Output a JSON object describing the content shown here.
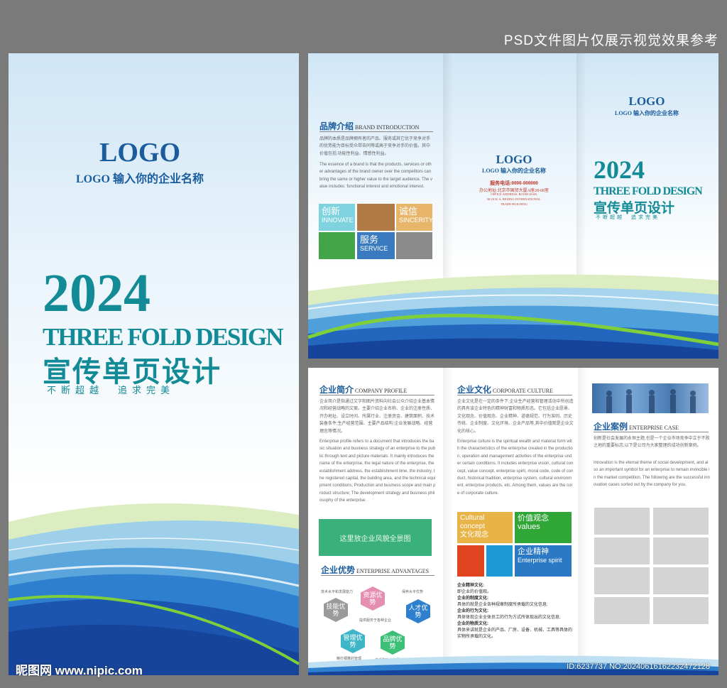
{
  "watermark_top": "PSD文件图片仅展示视觉效果参考",
  "watermark_site": "昵图网 www.nipic.com",
  "watermark_id": "ID:6237737 NO:20240616162232472128",
  "cover": {
    "logo": "LOGO",
    "company": "LOGO 输入你的企业名称",
    "year": "2024",
    "title_en": "THREE FOLD DESIGN",
    "title_cn": "宣传单页设计",
    "slogan": "不断超越　追求完美"
  },
  "outside": {
    "brand": {
      "heading": "品牌介绍",
      "heading_en": "BRAND INTRODUCTION",
      "text_cn": "品牌的本质是品牌拥有者的产品、服务或其它优于竞争对手的优势能为目标受众带去同等或高于竞争对手的价值。其中价值包括:功能性利益、情感性利益。",
      "text_en": "The essence of a brand is that the products, services or other advantages of the brand owner over the competitors can bring the same or higher value to the target audience. The value includes: functional interest and emotional interest."
    },
    "tiles": [
      {
        "cn": "创新",
        "en": "INNOVATE",
        "color": "#7fd3df"
      },
      {
        "cn": "",
        "en": "",
        "color": "#b07a45"
      },
      {
        "cn": "诚信",
        "en": "SINCERITY",
        "color": "#e7b66a"
      },
      {
        "cn": "",
        "en": "",
        "color": "#43a548"
      },
      {
        "cn": "服务",
        "en": "SERVICE",
        "color": "#3a7bbf"
      },
      {
        "cn": "",
        "en": "",
        "color": "#8a8a8a"
      }
    ],
    "back": {
      "logo": "LOGO",
      "company": "LOGO 输入你的企业名称",
      "phone": "服务电话:0000-000000",
      "address_cn": "办公地址:北京市国贸大厦A座28-08室",
      "address_en_1": "OFFICE ADDRESS: ROOM 28-08,",
      "address_en_2": "BLOCK A, BEIJING INTERNATIONAL",
      "address_en_3": "TRADE BUILDING"
    },
    "front": {
      "logo": "LOGO",
      "company": "LOGO 输入你的企业名称",
      "year": "2024",
      "title_en": "THREE FOLD DESIGN",
      "title_cn": "宣传单页设计",
      "slogan": "不断超越　追求完美"
    }
  },
  "inside": {
    "profile": {
      "heading": "企业简介",
      "heading_en": "COMPANY PROFILE",
      "text_cn": "企业简介是指通过文字和图片资料向社会公众介绍企业基本情况和经营战略的文案。主要介绍企业名称、企业的注册性质、开办地址、设立时间、所属行业、注册资金、建筑面积、技术装备条件;生产经营范围、主要产品结构;企业发展战略、经营理念等情况。",
      "text_en": "Enterprise profile refers to a document that introduces the basic situation and business strategy of an enterprise to the public through text and picture materials. It mainly introduces the name of the enterprise, the legal nature of the enterprise, the establishment address, the establishment time, the industry, the registered capital, the building area, and the technical equipment conditions; Production and business scope and main product structure; The development strategy and business philosophy of the enterprise.",
      "image_placeholder": "这里放企业风貌全景图"
    },
    "advantages": {
      "heading": "企业优势",
      "heading_en": "ENTERPRISE ADVANTAGES",
      "items": [
        {
          "label": "技能优势",
          "color": "#9a9a9a"
        },
        {
          "label": "资源优势",
          "color": "#e48fb1"
        },
        {
          "label": "人才优势",
          "color": "#2f7fcf"
        },
        {
          "label": "管理优势",
          "color": "#3fb6c8"
        },
        {
          "label": "品牌优势",
          "color": "#3ebf78"
        }
      ],
      "notes": [
        "技术水平和发展能力",
        "保养水平优势",
        "提供服务于各种企业",
        "精打细算的管理",
        "广泛影响力的品牌"
      ]
    },
    "culture": {
      "heading": "企业文化",
      "heading_en": "CORPORATE CULTURE",
      "text_cn": "企业文化是在一定的条件下,企业生产经营和管理活动中所创造的具有该企业特色的精神财富和物质形态。它包括企业愿景、文化观念、价值观念、企业精神、道德规范、行为准则、历史传统、企业制度、文化环境、企业产品等,其中价值观是企业文化的核心。",
      "text_en": "Enterprise culture is the spiritual wealth and material form with the characteristics of the enterprise created in the production, operation and management activities of the enterprise under certain conditions. It includes enterprise vision, cultural concept, value concept, enterprise spirit, moral code, code of conduct, historical tradition, enterprise system, cultural environment, enterprise products, etc. Among them, values are the core of corporate culture.",
      "tiles": [
        {
          "cn": "Cultural concept",
          "en": "文化观念",
          "color": "#e9b447"
        },
        {
          "cn": "价值观念",
          "en": "values",
          "color": "#2fa635"
        },
        {
          "cn": "",
          "en": "",
          "color": "#e0431f"
        },
        {
          "cn": "",
          "en": "",
          "color": "#1d9ad6"
        },
        {
          "cn": "企业精神",
          "en": "Enterprise spirit",
          "color": "#2b78c4"
        }
      ],
      "points": [
        {
          "title": "企业精神文化:",
          "text": "即企业的价值观。"
        },
        {
          "title": "企业的制度文化:",
          "text": "具体的就是企业各种规章制度所承载的文化信息;"
        },
        {
          "title": "企业的行为文化:",
          "text": "具体体现企业全体员工的行为方式所体现出的文化信息;"
        },
        {
          "title": "企业的物质文化:",
          "text": "具体来讲就是企业的产品、厂房、设备、机械、工具等具体的实物所承载的文化。"
        }
      ]
    },
    "cases": {
      "heading": "企业案例",
      "heading_en": "ENTERPRISE CASE",
      "text_cn": "创新是社会发展的永恒主题,也是一个企业市场竞争中立于不败之地的重要标志,以下是公司为大家整理的成功创新案例。",
      "text_en": "Innovation is the eternal theme of social development, and also an important symbol for an enterprise to remain invincible in the market competition. The following are the successful innovation cases sorted out by the company for you."
    }
  },
  "colors": {
    "teal": "#128b96",
    "navy": "#1b5d9c",
    "background": "#7a7a7a"
  }
}
